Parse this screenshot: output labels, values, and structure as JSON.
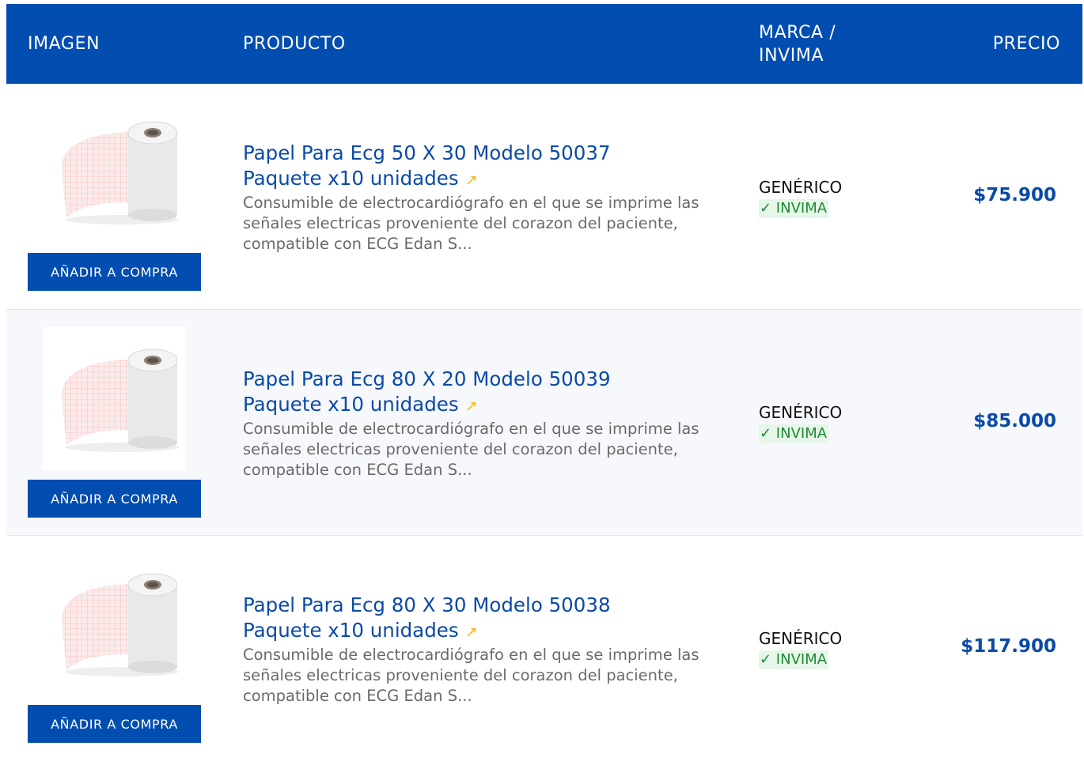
{
  "header": {
    "col_image": "IMAGEN",
    "col_product": "PRODUCTO",
    "col_brand": "MARCA / INVIMA",
    "col_price": "PRECIO"
  },
  "rows": [
    {
      "title": "Papel Para Ecg 50 X 30 Modelo 50037 Paquete x10 unidades",
      "description": "Consumible de electrocardiógrafo en el que se imprime las señales electricas proveniente del corazon del paciente, compatible con ECG Edan S...",
      "brand": "GENÉRICO",
      "invima": "✓ INVIMA",
      "price": "$75.900",
      "button": "AÑADIR A COMPRA",
      "image_icon": "ecg-paper-roll-icon"
    },
    {
      "title": "Papel Para Ecg 80 X 20 Modelo 50039 Paquete x10 unidades",
      "description": "Consumible de electrocardiógrafo en el que se imprime las señales electricas proveniente del corazon del paciente, compatible con ECG Edan S...",
      "brand": "GENÉRICO",
      "invima": "✓ INVIMA",
      "price": "$85.000",
      "button": "AÑADIR A COMPRA",
      "image_icon": "ecg-paper-roll-icon"
    },
    {
      "title": "Papel Para Ecg 80 X 30 Modelo 50038 Paquete x10 unidades",
      "description": "Consumible de electrocardiógrafo en el que se imprime las señales electricas proveniente del corazon del paciente, compatible con ECG Edan S...",
      "brand": "GENÉRICO",
      "invima": "✓ INVIMA",
      "price": "$117.900",
      "button": "AÑADIR A COMPRA",
      "image_icon": "ecg-paper-roll-icon"
    }
  ],
  "colors": {
    "header_bg": "#014db0",
    "link": "#0a4aa6",
    "invima_bg": "#e6f6e8",
    "invima_text": "#1e8a36",
    "external_arrow": "#f2b90f"
  }
}
